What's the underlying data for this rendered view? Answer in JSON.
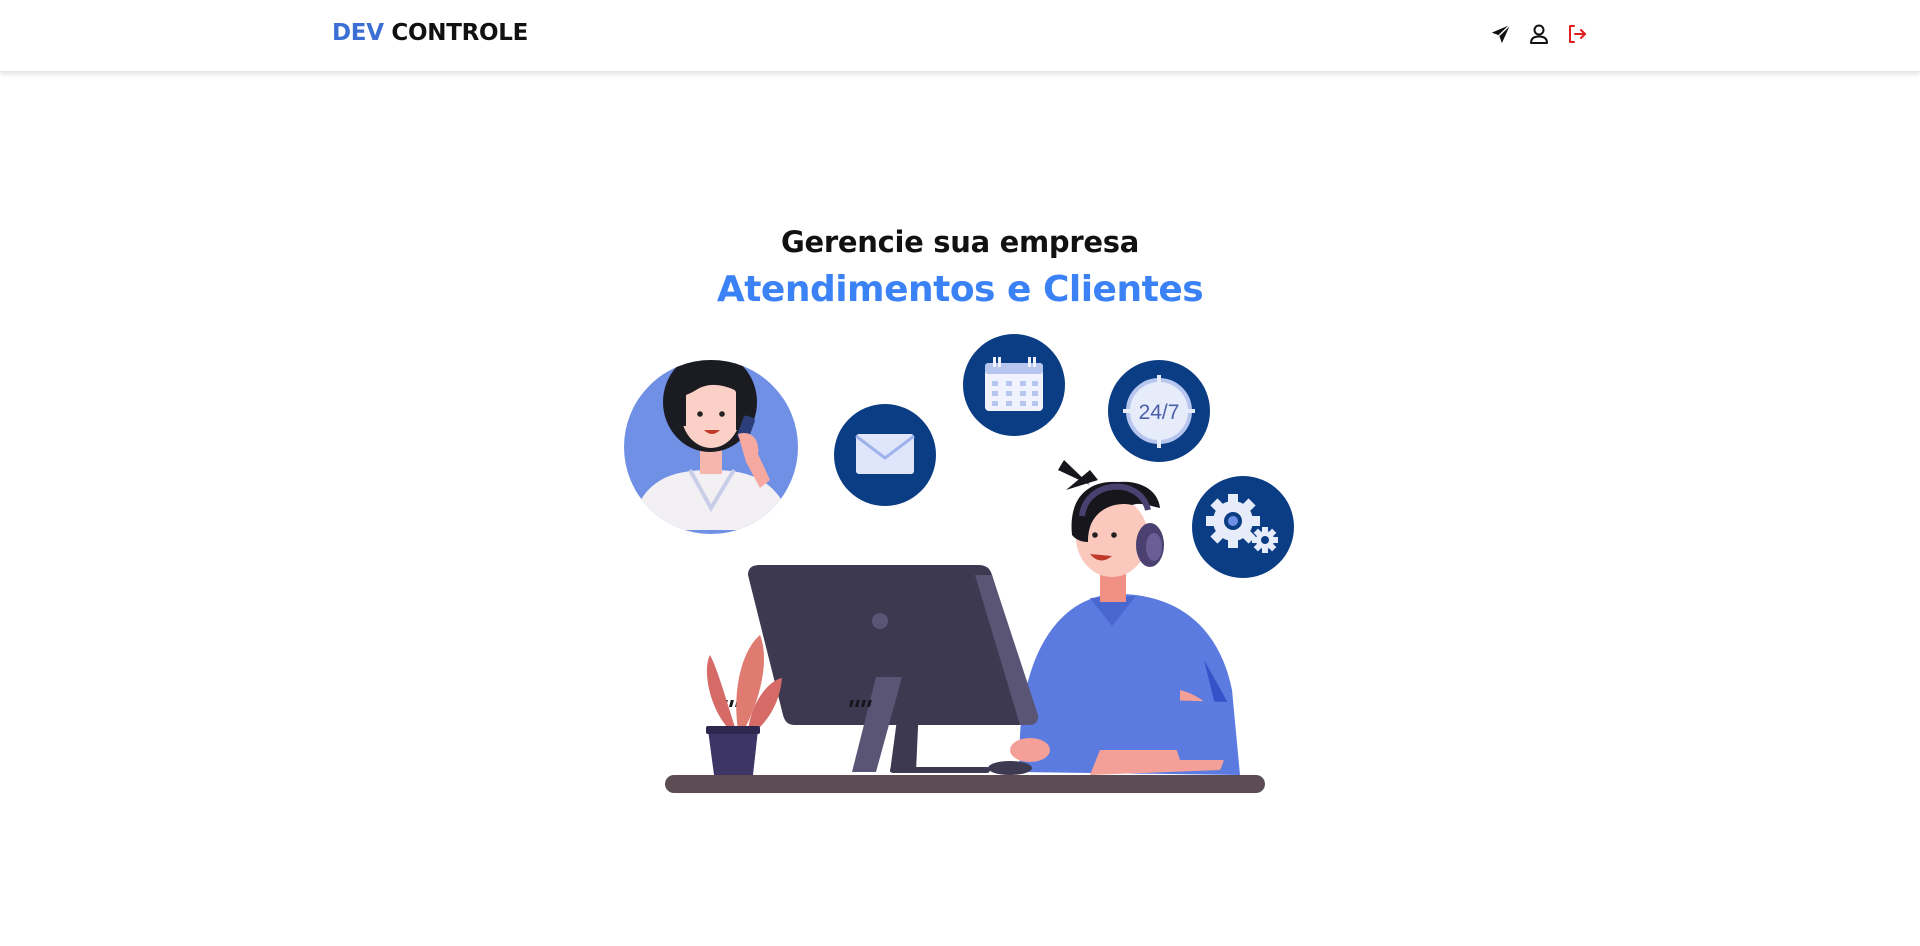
{
  "header": {
    "logo": {
      "part1": "DEV",
      "part2": " CONTROLE"
    },
    "icons": [
      {
        "name": "send-icon",
        "color": "#111111"
      },
      {
        "name": "user-icon",
        "color": "#111111"
      },
      {
        "name": "logout-icon",
        "color": "#e11d1d"
      }
    ]
  },
  "hero": {
    "title": "Gerencie sua empresa",
    "subtitle": "Atendimentos e Clientes"
  },
  "illustration": {
    "badge_text": "24/7",
    "colors": {
      "accent": "#3b6fd4",
      "subtitle": "#3b82f6",
      "circle_dark": "#0b3d85",
      "circle_light": "#7090e6",
      "shirt": "#5b7be0",
      "monitor": "#3d3950",
      "desk": "#5e4c55",
      "plant": "#d66a66"
    }
  }
}
